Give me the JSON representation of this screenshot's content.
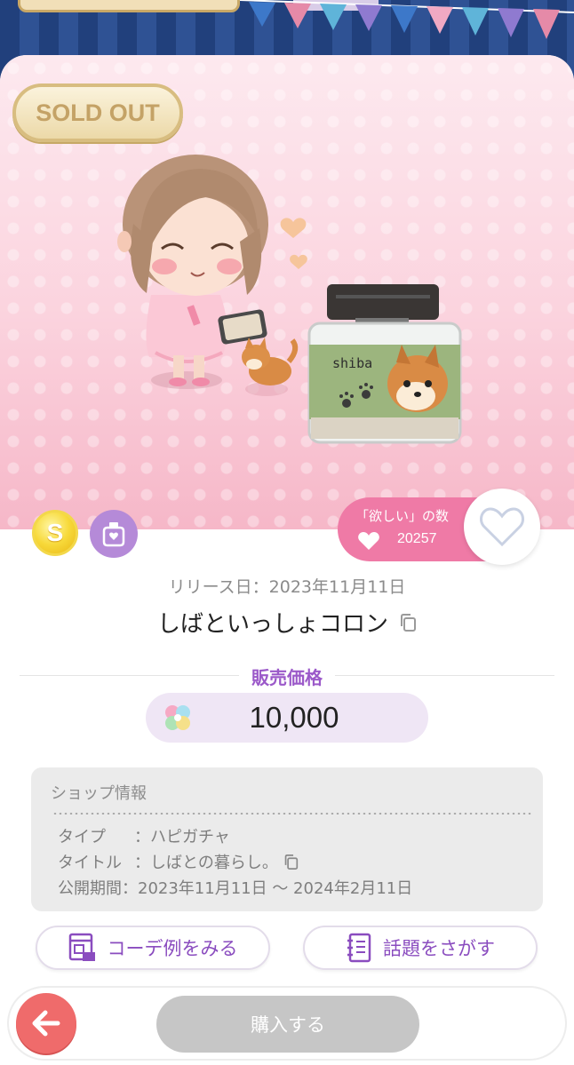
{
  "colors": {
    "backdrop": "#2c4a86",
    "hero_pink": "#fbd3de",
    "wish_pink": "#ef7aa6",
    "price_purple": "#9b59c9",
    "back_red": "#ef6b6b",
    "buy_disabled": "#c6c6c6"
  },
  "status_badge": "SOLD OUT",
  "badges": {
    "coin_letter": "S",
    "coin_icon": "gold-coin-icon",
    "category_icon": "perfume-bottle-icon"
  },
  "wishlist": {
    "label": "「欲しい」の数",
    "count": "20257",
    "heart_icon": "heart-icon",
    "button_icon": "heart-outline-icon"
  },
  "item": {
    "release_text": "リリース日：2023年11月11日",
    "name": "しばといっしょコロン",
    "label_text": "shiba"
  },
  "price": {
    "title": "販売価格",
    "currency_icon": "clover-gem-icon",
    "value": "10,000"
  },
  "shop_info": {
    "title": "ショップ情報",
    "type_label": "タイプ",
    "type_value": "：ハピガチャ",
    "title_label": "タイトル",
    "title_value": "：しばとの暮らし。",
    "period_label": "公開期間",
    "period_value": "：2023年11月11日 ～ 2024年2月11日"
  },
  "actions": {
    "coord_example": "コーデ例をみる",
    "find_topic": "話題をさがす",
    "buy": "購入する"
  }
}
